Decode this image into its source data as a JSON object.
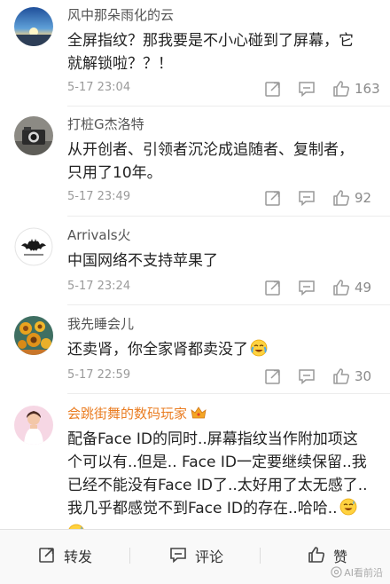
{
  "comments": [
    {
      "username": "风中那朵雨化的云",
      "avatar": "sunset-avatar",
      "lines": [
        "全屏指纹？那我要是不小心碰到了屏幕，它",
        "就解锁啦？？！"
      ],
      "time": "5-17 23:04",
      "likes": "163"
    },
    {
      "username": "打桩G杰洛特",
      "avatar": "camera-avatar",
      "lines": [
        "从开创者、引领者沉沦成追随者、复制者，",
        "只用了10年。"
      ],
      "time": "5-17 23:49",
      "likes": "92"
    },
    {
      "username": "Arrivals火",
      "avatar": "bat-logo-avatar",
      "lines": [
        "中国网络不支持苹果了"
      ],
      "time": "5-17 23:24",
      "likes": "49"
    },
    {
      "username": "我先睡会儿",
      "avatar": "sunflowers-avatar",
      "lines": [
        "还卖肾，你全家肾都卖没了"
      ],
      "emoji": "crying-laughing-emoji",
      "time": "5-17 22:59",
      "likes": "30"
    },
    {
      "username": "会跳街舞的数码玩家",
      "avatar": "girl-avatar",
      "badge": "crown-vip-icon",
      "lines": [
        "配备Face ID的同时..屏幕指纹当作附加项这",
        "个可以有..但是.. Face ID一定要继续保留..我",
        "已经不能没有Face ID了..太好用了太无感了..",
        "我几乎都感觉不到Face ID的存在..哈哈.."
      ],
      "emoji": "grinning-sweat-emoji"
    }
  ],
  "actions": {
    "share_icon": "share-icon",
    "reply_icon": "reply-icon",
    "like_icon": "thumbs-up-icon"
  },
  "bottom_bar": {
    "repost_label": "转发",
    "comment_label": "评论",
    "like_label": "赞"
  },
  "watermark": "AI看前沿",
  "colors": {
    "vip_username": "#ea7d22",
    "username": "#555555",
    "text": "#222222",
    "timestamp": "#9a9a9a",
    "icon": "#999999"
  }
}
